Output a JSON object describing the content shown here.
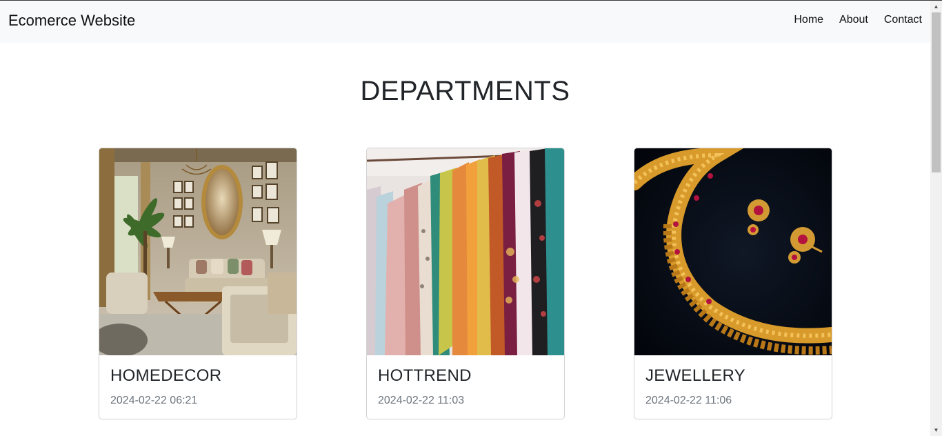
{
  "navbar": {
    "brand": "Ecomerce Website",
    "links": [
      "Home",
      "About",
      "Contact"
    ]
  },
  "main": {
    "heading": "DEPARTMENTS",
    "cards": [
      {
        "title": "HOMEDECOR",
        "date": "2024-02-22 06:21",
        "image": "living-room-photo"
      },
      {
        "title": "HOTTREND",
        "date": "2024-02-22 11:03",
        "image": "clothing-rack-photo"
      },
      {
        "title": "JEWELLERY",
        "date": "2024-02-22 11:06",
        "image": "gold-necklace-photo"
      }
    ]
  },
  "colors": {
    "navbar_bg": "#f8f9fa",
    "text": "#212529",
    "muted": "#6c757d"
  }
}
